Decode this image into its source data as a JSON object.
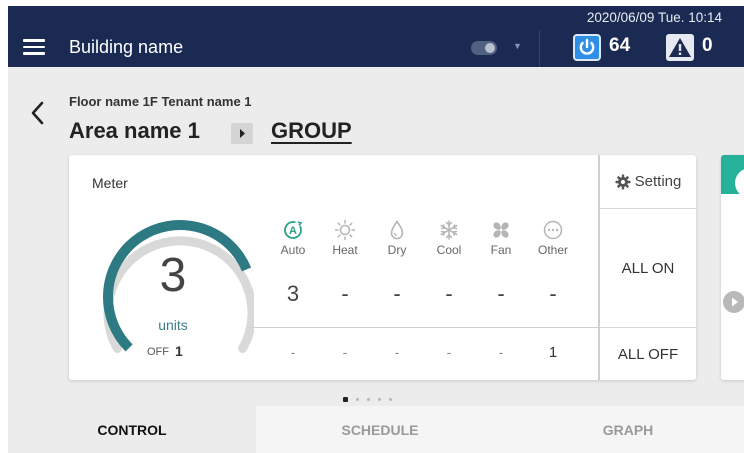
{
  "header": {
    "datetime": "2020/06/09 Tue. 10:14",
    "building_name": "Building name",
    "power_count": "64",
    "alert_count": "0"
  },
  "breadcrumb": {
    "floor_line": "Floor name 1F Tenant name 1",
    "area_name": "Area name 1",
    "group_label": "GROUP"
  },
  "card": {
    "meter_title": "Meter",
    "units_number": "3",
    "units_label": "units",
    "off_label": "OFF",
    "off_value": "1",
    "gauge_on_fraction": 0.75,
    "modes": [
      {
        "label": "Auto",
        "icon": "auto-mode-icon",
        "on_value": "3",
        "off_value": "-"
      },
      {
        "label": "Heat",
        "icon": "sun-icon",
        "on_value": "-",
        "off_value": "-"
      },
      {
        "label": "Dry",
        "icon": "droplet-icon",
        "on_value": "-",
        "off_value": "-"
      },
      {
        "label": "Cool",
        "icon": "snowflake-icon",
        "on_value": "-",
        "off_value": "-"
      },
      {
        "label": "Fan",
        "icon": "fan-icon",
        "on_value": "-",
        "off_value": "-"
      },
      {
        "label": "Other",
        "icon": "ellipsis-circle-icon",
        "on_value": "-",
        "off_value": "1"
      }
    ],
    "setting_label": "Setting",
    "all_on_label": "ALL ON",
    "all_off_label": "ALL OFF"
  },
  "pager": {
    "page_count": 5,
    "active_index": 0
  },
  "tabs": [
    {
      "label": "CONTROL",
      "active": true
    },
    {
      "label": "SCHEDULE",
      "active": false
    },
    {
      "label": "GRAPH",
      "active": false
    }
  ],
  "colors": {
    "header_bg": "#1b2a52",
    "accent_teal": "#2e7a83",
    "power_blue": "#2f8ee6",
    "auto_green": "#25a383",
    "next_card_accent": "#25b19a"
  }
}
